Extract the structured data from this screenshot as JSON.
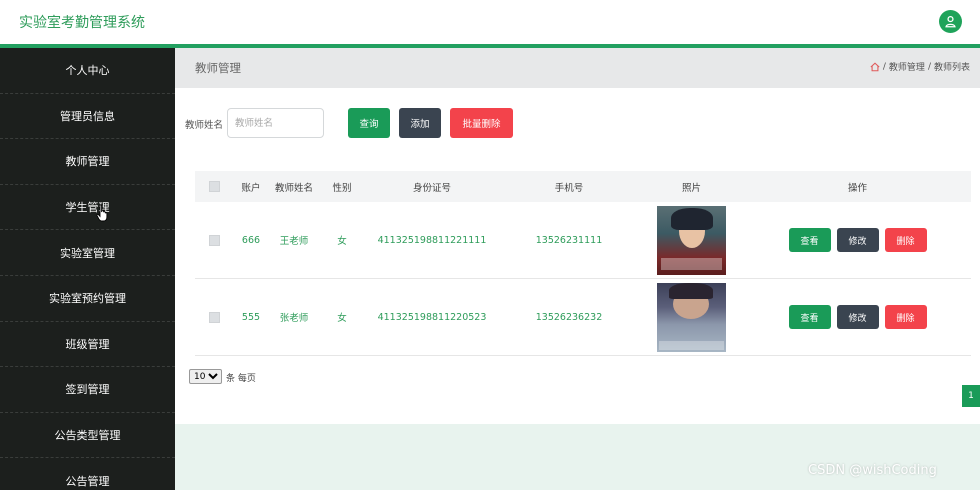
{
  "header": {
    "app_title": "实验室考勤管理系统",
    "avatar_icon": "user-icon"
  },
  "sidebar": {
    "items": [
      {
        "label": "个人中心"
      },
      {
        "label": "管理员信息"
      },
      {
        "label": "教师管理"
      },
      {
        "label": "学生管理"
      },
      {
        "label": "实验室管理"
      },
      {
        "label": "实验室预约管理"
      },
      {
        "label": "班级管理"
      },
      {
        "label": "签到管理"
      },
      {
        "label": "公告类型管理"
      },
      {
        "label": "公告管理"
      }
    ]
  },
  "breadcrumb": {
    "page_heading": "教师管理",
    "home_icon": "home-icon",
    "separator": "/",
    "items": [
      "教师管理",
      "教师列表"
    ]
  },
  "search": {
    "label": "教师姓名",
    "placeholder": "教师姓名",
    "query_label": "查询",
    "add_label": "添加",
    "batch_delete_label": "批量删除"
  },
  "table": {
    "headers": {
      "account": "账户",
      "name": "教师姓名",
      "gender": "性别",
      "idcard": "身份证号",
      "phone": "手机号",
      "photo": "照片",
      "ops": "操作"
    },
    "rows": [
      {
        "account": "666",
        "name": "王老师",
        "gender": "女",
        "idcard": "411325198811221111",
        "phone": "13526231111"
      },
      {
        "account": "555",
        "name": "张老师",
        "gender": "女",
        "idcard": "411325198811220523",
        "phone": "13526236232"
      }
    ],
    "actions": {
      "view": "查看",
      "edit": "修改",
      "delete": "删除"
    }
  },
  "pagination": {
    "page_size": "10",
    "page_size_suffix": "条 每页",
    "current_page": "1"
  },
  "watermark": "CSDN @wishCoding",
  "colors": {
    "accent": "#1a9b58",
    "dark_button": "#3a4450",
    "danger": "#f3434b",
    "sidebar_bg": "#1c1f1d"
  }
}
